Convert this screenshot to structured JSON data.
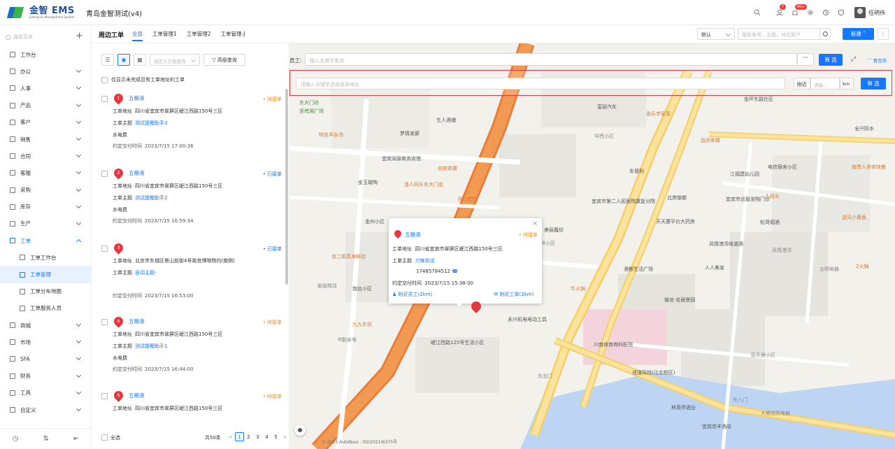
{
  "header": {
    "logo_text": "金智 EMS",
    "logo_sub": "Enterprise Management System",
    "app_title": "青岛金智测试(v4)",
    "badge_contacts": "7",
    "badge_notify": "99+",
    "user_name": "任明伟"
  },
  "sidebar": {
    "search_placeholder": "搜索菜单",
    "items": [
      {
        "label": "工作台",
        "icon": "workbench-icon",
        "chev": false
      },
      {
        "label": "办公",
        "icon": "office-icon",
        "chev": true
      },
      {
        "label": "人事",
        "icon": "hr-icon",
        "chev": true
      },
      {
        "label": "产品",
        "icon": "product-icon",
        "chev": true
      },
      {
        "label": "客户",
        "icon": "customer-icon",
        "chev": true
      },
      {
        "label": "销售",
        "icon": "sales-icon",
        "chev": true
      },
      {
        "label": "合同",
        "icon": "contract-icon",
        "chev": true
      },
      {
        "label": "客服",
        "icon": "service-icon",
        "chev": true
      },
      {
        "label": "采购",
        "icon": "purchase-icon",
        "chev": true
      },
      {
        "label": "库存",
        "icon": "inventory-icon",
        "chev": true
      },
      {
        "label": "生产",
        "icon": "production-icon",
        "chev": true
      },
      {
        "label": "工单",
        "icon": "workorder-icon",
        "chev": true,
        "active": true
      }
    ],
    "sub_items": [
      {
        "label": "工单工作台",
        "icon": "workorder-desk-icon"
      },
      {
        "label": "工单管理",
        "icon": "workorder-manage-icon",
        "selected": true
      },
      {
        "label": "工单分布地图",
        "icon": "workorder-map-icon"
      },
      {
        "label": "工单服务人员",
        "icon": "workorder-staff-icon"
      }
    ],
    "items_after": [
      {
        "label": "商城",
        "icon": "mall-icon"
      },
      {
        "label": "市场",
        "icon": "market-icon"
      },
      {
        "label": "SFA",
        "icon": "sfa-icon"
      },
      {
        "label": "财务",
        "icon": "finance-icon"
      },
      {
        "label": "工具",
        "icon": "tools-icon"
      },
      {
        "label": "自定义",
        "icon": "custom-icon"
      }
    ]
  },
  "page": {
    "title": "周边工单",
    "tabs": [
      "全部",
      "工单管理1",
      "工单管理2",
      "工单管理-J"
    ],
    "sort_value": "默认",
    "search_placeholder": "搜索单号、主题、对应客户",
    "new_label": "新建"
  },
  "list": {
    "custom_query_placeholder": "自定义方案查询",
    "advanced_label": "高级查询",
    "filter_label": "仅显示未完成且有工单地址的工单",
    "cards": [
      {
        "num": "1",
        "name": "五粮液",
        "status": "待接单",
        "status_type": "pending",
        "addr_label": "工单地址",
        "addr": "四川省宜宾市翠屏区岷江西路150号三区",
        "topic_label": "工单主题",
        "topic": "测试提醒助手3",
        "extra": "水电费",
        "time_label": "约定交付时间",
        "time": "2023/7/15 17:00:36"
      },
      {
        "num": "2",
        "name": "五粮液",
        "status": "已接单",
        "status_type": "taken",
        "addr_label": "工单地址",
        "addr": "四川省宜宾市翠屏区岷江西路150号三区",
        "topic_label": "工单主题",
        "topic": "测试提醒助手2",
        "extra": "水电费",
        "time_label": "约定交付时间",
        "time": "2023/7/15 16:59:34"
      },
      {
        "num": "3",
        "name": "",
        "status": "已接单",
        "status_type": "taken",
        "addr_label": "工单地址",
        "addr": "北京市东城区景山前街4号故宫博物院内(南侧)",
        "topic_label": "工单主题",
        "topic": "自动主题-",
        "extra": "",
        "time_label": "约定交付时间",
        "time": "2023/7/15 16:53:00"
      },
      {
        "num": "4",
        "name": "五粮液",
        "status": "待接单",
        "status_type": "pending",
        "addr_label": "工单地址",
        "addr": "四川省宜宾市翠屏区岷江西路150号三区",
        "topic_label": "工单主题",
        "topic": "测试提醒助手1",
        "extra": "水电费",
        "time_label": "约定交付时间",
        "time": "2023/7/15 16:44:00"
      },
      {
        "num": "5",
        "name": "五粮液",
        "status": "待接单",
        "status_type": "pending",
        "addr_label": "工单地址",
        "addr": "四川省宜宾市翠屏区岷江西路150号三区"
      }
    ],
    "select_all": "全选",
    "total": "共50条",
    "pages": [
      "1",
      "2",
      "3",
      "4",
      "5"
    ],
    "current_page": "1"
  },
  "map": {
    "employee_label": "员工:",
    "employee_placeholder": "输入关键字查询",
    "filter_label": "筛 选",
    "city": "青岛市",
    "address_placeholder": "请输入关键字选择基准地址",
    "near_label": "附近",
    "near_placeholder": "请输...",
    "km_label": "km",
    "copyright": "© 2023 AutoNavi - GS(2021)6375号",
    "labels": [
      "东大门坊",
      "坚垮酒广场",
      "特色羊杂汤",
      "梦情发廊",
      "生人酒铺",
      "富丽汽车",
      "香乐芋家菜",
      "华西小区",
      "宜宾润源商务宾馆",
      "向皮茶楼",
      "品闲茶楼",
      "南岸人茶茶快餐",
      "金玉玻陶",
      "渔人码头东大门店",
      "车便利",
      "北岸银都",
      "江福建幼儿园",
      "电信宿舍小区",
      "开心蛋饺",
      "宜宾市第二人民医院康复分院",
      "宜宾市远智宠物门诊",
      "人码头",
      "金州小区",
      "美丽魔坊",
      "天天康平价大药房",
      "松哥烟酒",
      "透兄小黄鱼",
      "肖二姐蒸海鲜店",
      "风情港湾缘湖酒",
      "风情港湾",
      "圈林小区",
      "酒都生活广场",
      "人人美发",
      "五明电器",
      "2火锅",
      "服装精改",
      "炮台小区",
      "牛火锅",
      "银龙·名居景园",
      "九九东坊",
      "书勤亲电",
      "永兴机电电动工具",
      "川南体育骨科医院",
      "民乐居小区",
      "岷江西路125号生活小区",
      "戎强驾校(江北校区)",
      "东北门",
      "林英停酒业",
      "宜宾京丰酒店",
      "大餐收购电器",
      "全兴防水",
      "金环东路社区",
      "东八门"
    ]
  },
  "popup": {
    "name": "五粮液",
    "status": "待接单",
    "addr_label": "工单地址",
    "addr": "四川省宜宾市翠屏区岷江西路150号三区",
    "topic_label": "工单主题",
    "topic": "刀锋测试",
    "phone": "17485784512",
    "time_label": "约定交付时间",
    "time": "2023/7/15 15:38:00",
    "near_staff": "附近员工(2km)",
    "near_orders": "附近工单(2km)"
  },
  "colors": {
    "accent": "#1677ff",
    "pending": "#fa8c16",
    "marker": "#e8363f"
  }
}
